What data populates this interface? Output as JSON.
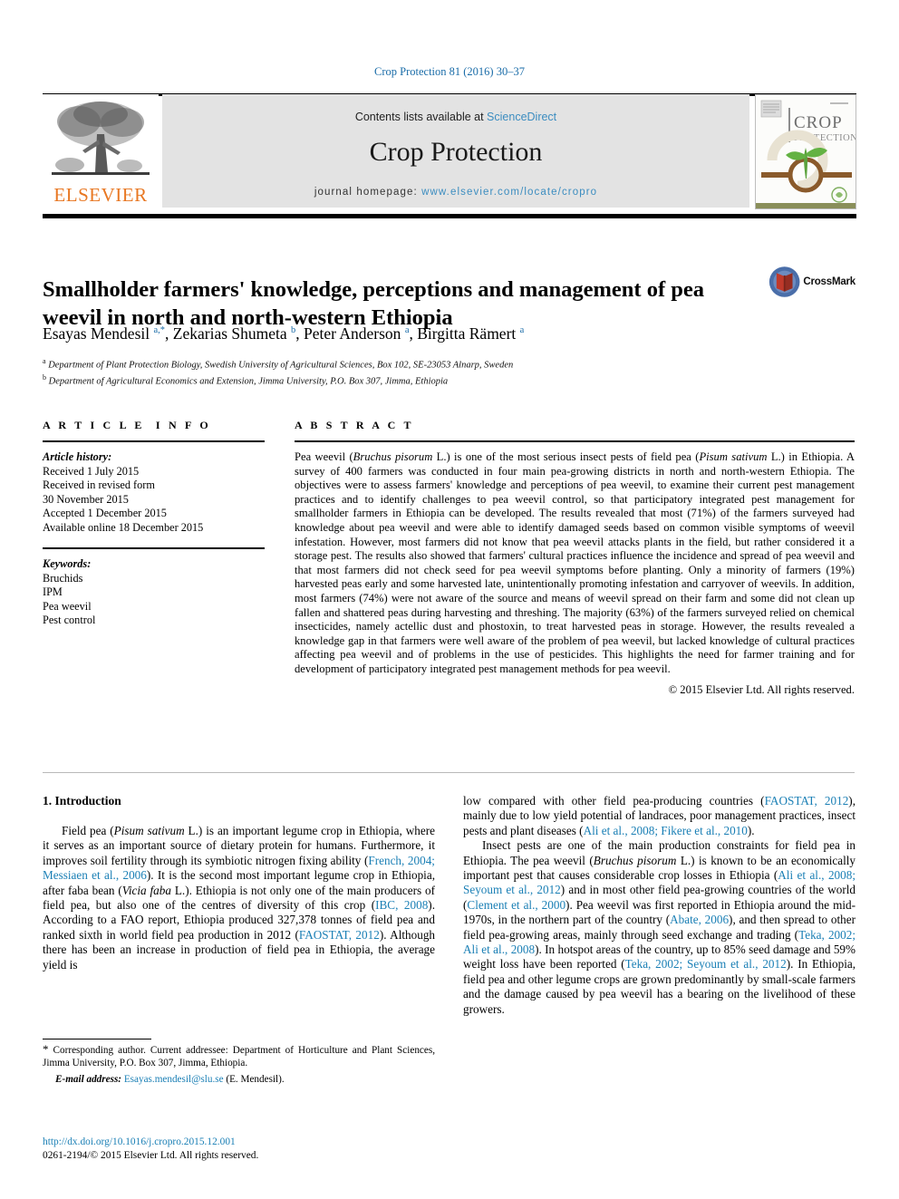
{
  "running_head": "Crop Protection 81 (2016) 30–37",
  "masthead": {
    "publisher_logo_text": "ELSEVIER",
    "contents_prefix": "Contents lists available at ",
    "contents_link": "ScienceDirect",
    "journal_name": "Crop Protection",
    "homepage_prefix": "journal homepage: ",
    "homepage_link": "www.elsevier.com/locate/cropro",
    "cover": {
      "title_line1": "CROP",
      "title_line2": "PROTECTION"
    }
  },
  "article": {
    "title": "Smallholder farmers' knowledge, perceptions and management of pea weevil in north and north-western Ethiopia",
    "authors_html": "Esayas Mendesil <sup>a,&#42;</sup>, Zekarias Shumeta <sup>b</sup>, Peter Anderson <sup>a</sup>, Birgitta Rämert <sup>a</sup>",
    "affiliations": [
      {
        "marker": "a",
        "text": "Department of Plant Protection Biology, Swedish University of Agricultural Sciences, Box 102, SE-23053 Alnarp, Sweden"
      },
      {
        "marker": "b",
        "text": "Department of Agricultural Economics and Extension, Jimma University, P.O. Box 307, Jimma, Ethiopia"
      }
    ],
    "crossmark_label": "CrossMark"
  },
  "info": {
    "heading": "ARTICLE INFO",
    "history_label": "Article history:",
    "history": [
      "Received 1 July 2015",
      "Received in revised form",
      "30 November 2015",
      "Accepted 1 December 2015",
      "Available online 18 December 2015"
    ],
    "keywords_label": "Keywords:",
    "keywords": [
      "Bruchids",
      "IPM",
      "Pea weevil",
      "Pest control"
    ]
  },
  "abstract": {
    "heading": "ABSTRACT",
    "text_html": "Pea weevil (<i>Bruchus pisorum</i> L.) is one of the most serious insect pests of field pea (<i>Pisum sativum</i> L.) in Ethiopia. A survey of 400 farmers was conducted in four main pea-growing districts in north and north-western Ethiopia. The objectives were to assess farmers&#39; knowledge and perceptions of pea weevil, to examine their current pest management practices and to identify challenges to pea weevil control, so that participatory integrated pest management for smallholder farmers in Ethiopia can be developed. The results revealed that most (71%) of the farmers surveyed had knowledge about pea weevil and were able to identify damaged seeds based on common visible symptoms of weevil infestation. However, most farmers did not know that pea weevil attacks plants in the field, but rather considered it a storage pest. The results also showed that farmers&#39; cultural practices influence the incidence and spread of pea weevil and that most farmers did not check seed for pea weevil symptoms before planting. Only a minority of farmers (19%) harvested peas early and some harvested late, unintentionally promoting infestation and carryover of weevils. In addition, most farmers (74%) were not aware of the source and means of weevil spread on their farm and some did not clean up fallen and shattered peas during harvesting and threshing. The majority (63%) of the farmers surveyed relied on chemical insecticides, namely actellic dust and phostoxin, to treat harvested peas in storage. However, the results revealed a knowledge gap in that farmers were well aware of the problem of pea weevil, but lacked knowledge of cultural practices affecting pea weevil and of problems in the use of pesticides. This highlights the need for farmer training and for development of participatory integrated pest management methods for pea weevil.",
    "copyright": "© 2015 Elsevier Ltd. All rights reserved."
  },
  "body": {
    "section_number_title": "1. Introduction",
    "left_paragraph_html": "Field pea (<i>Pisum sativum</i> L.) is an important legume crop in Ethiopia, where it serves as an important source of dietary protein for humans. Furthermore, it improves soil fertility through its symbiotic nitrogen fixing ability (<span class=\"ref\">French, 2004; Messiaen et al., 2006</span>). It is the second most important legume crop in Ethiopia, after faba bean (<i>Vicia faba</i> L.). Ethiopia is not only one of the main producers of field pea, but also one of the centres of diversity of this crop (<span class=\"ref\">IBC, 2008</span>). According to a FAO report, Ethiopia produced 327,378 tonnes of field pea and ranked sixth in world field pea production in 2012 (<span class=\"ref\">FAOSTAT, 2012</span>). Although there has been an increase in production of field pea in Ethiopia, the average yield is",
    "right_paragraph_1_html": "low compared with other field pea-producing countries (<span class=\"ref\">FAOSTAT, 2012</span>), mainly due to low yield potential of landraces, poor management practices, insect pests and plant diseases (<span class=\"ref\">Ali et al., 2008; Fikere et al., 2010</span>).",
    "right_paragraph_2_html": "Insect pests are one of the main production constraints for field pea in Ethiopia. The pea weevil (<i>Bruchus pisorum</i> L.) is known to be an economically important pest that causes considerable crop losses in Ethiopia (<span class=\"ref\">Ali et al., 2008; Seyoum et al., 2012</span>) and in most other field pea-growing countries of the world (<span class=\"ref\">Clement et al., 2000</span>). Pea weevil was first reported in Ethiopia around the mid-1970s, in the northern part of the country (<span class=\"ref\">Abate, 2006</span>), and then spread to other field pea-growing areas, mainly through seed exchange and trading (<span class=\"ref\">Teka, 2002; Ali et al., 2008</span>). In hotspot areas of the country, up to 85% seed damage and 59% weight loss have been reported (<span class=\"ref\">Teka, 2002; Seyoum et al., 2012</span>). In Ethiopia, field pea and other legume crops are grown predominantly by small-scale farmers and the damage caused by pea weevil has a bearing on the livelihood of these growers."
  },
  "footnote": {
    "corresponding_html": "<span style=\"font-size:13px;line-height:0\">&#42;</span> Corresponding author. Current addressee: Department of Horticulture and Plant Sciences, Jimma University, P.O. Box 307, Jimma, Ethiopia.",
    "email_label": "E-mail address:",
    "email": "Esayas.mendesil@slu.se",
    "email_owner": "(E. Mendesil)."
  },
  "doi": {
    "url": "http://dx.doi.org/10.1016/j.cropro.2015.12.001",
    "issn_line": "0261-2194/© 2015 Elsevier Ltd. All rights reserved."
  },
  "colors": {
    "link": "#1a7fb5",
    "elsevier_orange": "#E87722",
    "masthead_bg": "#e3e3e3"
  }
}
